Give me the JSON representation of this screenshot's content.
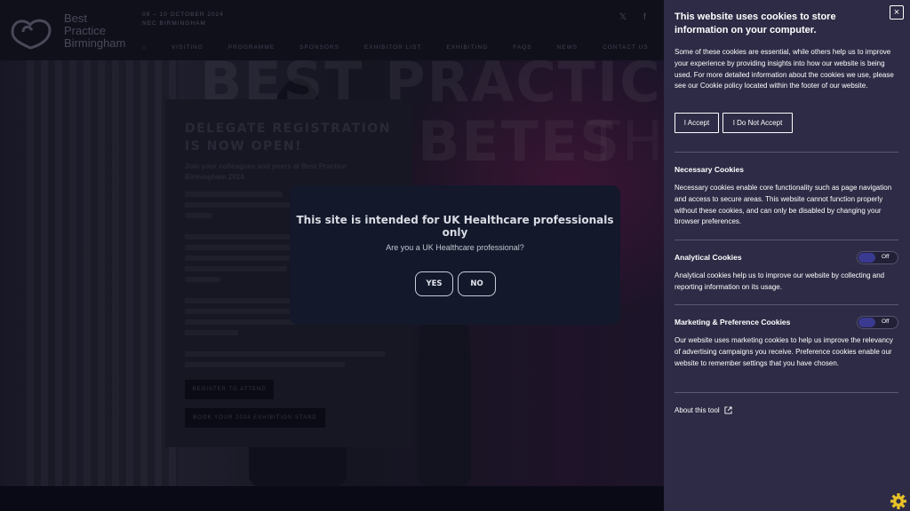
{
  "site": {
    "logo_line1": "Best",
    "logo_line2": "Practice",
    "logo_line3": "Birmingham",
    "event_date_line1": "09 – 10 OCTOBER 2024",
    "event_date_line2": "NEC BIRMINGHAM",
    "social": [
      "𝕏",
      "f"
    ],
    "nav": [
      "⌂",
      "VISITING",
      "PROGRAMME",
      "SPONSORS",
      "EXHIBITOR LIST",
      "EXHIBITING",
      "FAQS",
      "NEWS",
      "CONTACT US"
    ],
    "hero_text_line1": "BEST PRACTICE",
    "hero_text_line2": "BETES",
    "hero_text_line3": "TH",
    "registration": {
      "title": "DELEGATE REGISTRATION IS NOW OPEN!",
      "subtitle": "Join your colleagues and peers at Best Practice Birmingham 2024",
      "button1": "REGISTER TO ATTEND",
      "button2": "BOOK YOUR 2024 EXHIBITION STAND"
    }
  },
  "modal": {
    "title": "This site is intended for UK Healthcare professionals only",
    "question": "Are you a UK Healthcare professional?",
    "yes_label": "YES",
    "no_label": "NO"
  },
  "cookie_panel": {
    "title": "This website uses cookies to store information on your computer.",
    "intro": "Some of these cookies are essential, while others help us to improve your experience by providing insights into how our website is being used. For more detailed information about the cookies we use, please see our Cookie policy located within the footer of our website.",
    "accept_label": "I Accept",
    "reject_label": "I Do Not Accept",
    "close_icon": "×",
    "sections": [
      {
        "title": "Necessary Cookies",
        "text": "Necessary cookies enable core functionality such as page navigation and access to secure areas. This website cannot function properly without these cookies, and can only be disabled by changing your browser preferences."
      },
      {
        "title": "Analytical Cookies",
        "text": "Analytical cookies help us to improve our website by collecting and reporting information on its usage.",
        "toggle_state": "Off"
      },
      {
        "title": "Marketing & Preference Cookies",
        "text": "Our website uses marketing cookies to help us improve the relevancy of advertising campaigns you receive. Preference cookies enable our website to remember settings that you have chosen.",
        "toggle_state": "Off"
      }
    ],
    "about_label": "About this tool",
    "accent_color": "#2d2b45",
    "gear_color": "#e8c227"
  }
}
